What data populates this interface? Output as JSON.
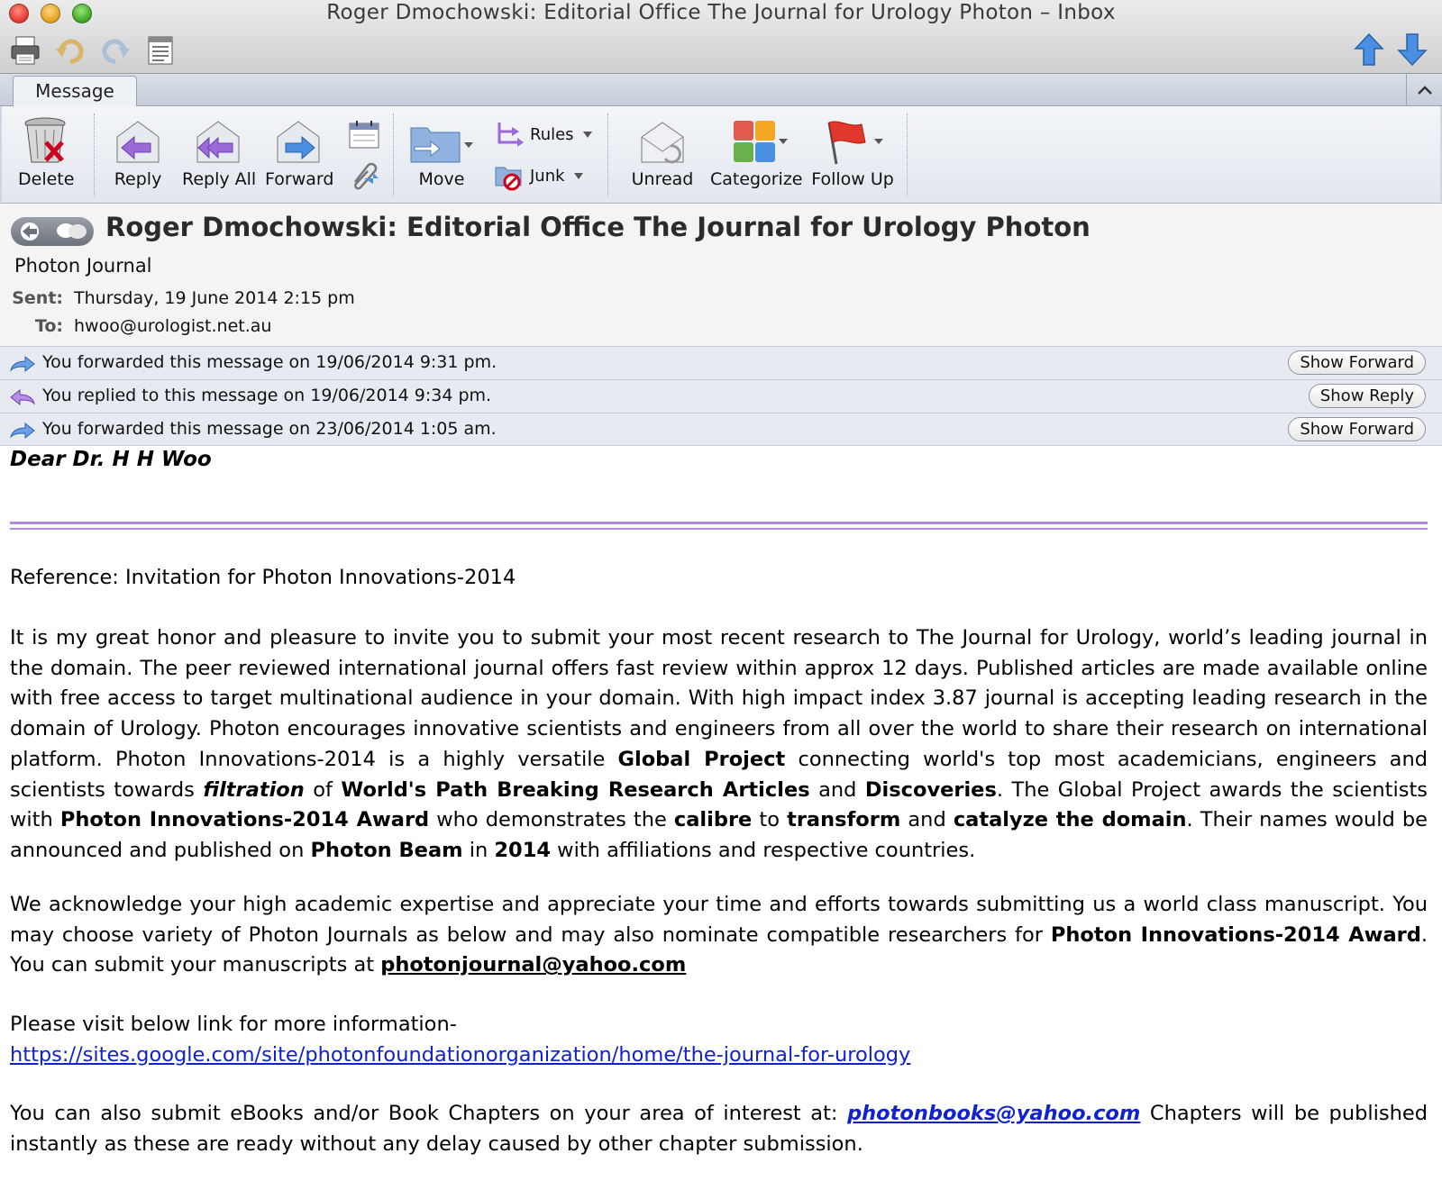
{
  "window": {
    "title": "Roger Dmochowski: Editorial Office The Journal for Urology Photon – Inbox"
  },
  "tabs": {
    "message": "Message"
  },
  "ribbon": {
    "delete": "Delete",
    "reply": "Reply",
    "reply_all": "Reply All",
    "forward": "Forward",
    "move": "Move",
    "rules": "Rules",
    "junk": "Junk",
    "unread": "Unread",
    "categorize": "Categorize",
    "follow_up": "Follow Up"
  },
  "header": {
    "subject": "Roger Dmochowski: Editorial Office The Journal for Urology Photon",
    "from": "Photon Journal",
    "sent_label": "Sent:",
    "sent_value": "Thursday, 19 June 2014 2:15 pm",
    "to_label": "To:",
    "to_value": "hwoo@urologist.net.au"
  },
  "notices": [
    {
      "text": "You forwarded this message on 19/06/2014 9:31 pm.",
      "button": "Show Forward"
    },
    {
      "text": "You replied to this message on 19/06/2014 9:34 pm.",
      "button": "Show Reply"
    },
    {
      "text": "You forwarded this message on 23/06/2014 1:05 am.",
      "button": "Show Forward"
    }
  ],
  "body": {
    "greeting": "Dear Dr. H H Woo",
    "reference": "Reference: Invitation for Photon Innovations-2014",
    "main": {
      "t1": "It is my great honor and pleasure to invite you to submit your most recent research to The Journal for Urology, world’s leading journal in the domain. The peer reviewed international journal offers fast review within approx 12 days. Published articles are made available online with free access to target multinational audience in your domain. With high impact index 3.87 journal is accepting leading research in the domain of Urology. Photon encourages innovative scientists and engineers from all over the world to share their research on international platform. Photon Innovations-2014 is a highly versatile ",
      "b1": "Global Project",
      "t2": " connecting world's top most academicians, engineers and scientists towards ",
      "bi1": "filtration",
      "t3": " of ",
      "b2": "World's Path Breaking Research Articles",
      "t4": " and ",
      "b3": "Discoveries",
      "t5": ". The Global Project awards the scientists with ",
      "b4": "Photon Innovations-2014 Award",
      "t6": " who demonstrates the ",
      "b5": "calibre",
      "t7": " to ",
      "b6": "transform",
      "t8": " and ",
      "b7": "catalyze the domain",
      "t9": ". Their names would be announced and published on ",
      "b8": "Photon Beam",
      "t10": " in ",
      "b9": "2014",
      "t11": " with affiliations and respective countries."
    },
    "ack": {
      "t1": "We acknowledge your high academic expertise and appreciate your time and efforts towards submitting us a world class manuscript. You may choose variety of Photon Journals as below and may also nominate compatible researchers for ",
      "b1": "Photon Innovations-2014 Award",
      "t2": ". You can submit your manuscripts at ",
      "email": "photonjournal@yahoo.com"
    },
    "visit": {
      "text": "Please visit below link for more information-",
      "url": "https://sites.google.com/site/photonfoundationorganization/home/the-journal-for-urology"
    },
    "books": {
      "t1": "You can also submit eBooks and/or Book Chapters on your area of interest at: ",
      "email": "photonbooks@yahoo.com",
      "t2": " Chapters will be published instantly as these are ready without any delay caused by other chapter submission."
    }
  },
  "colors": {
    "divider": "#b48ae0",
    "link": "#1122cc"
  }
}
